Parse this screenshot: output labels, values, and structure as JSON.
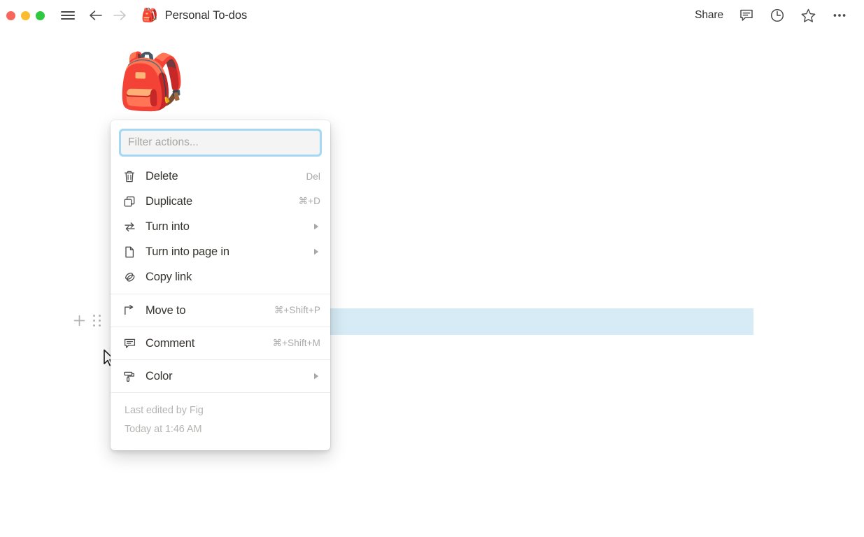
{
  "titlebar": {
    "window_controls": [
      {
        "name": "close",
        "color": "#f9655b"
      },
      {
        "name": "minimize",
        "color": "#fbbd2e"
      },
      {
        "name": "maximize",
        "color": "#2fc840"
      }
    ],
    "menu_icon": "hamburger-icon",
    "back_icon": "arrow-left-icon",
    "forward_icon": "arrow-right-icon",
    "doc_emoji": "🎒",
    "doc_title": "Personal To-dos",
    "share_label": "Share",
    "comment_icon": "comment-icon",
    "history_icon": "clock-icon",
    "favorite_icon": "star-icon",
    "more_icon": "ellipsis-icon"
  },
  "page": {
    "emoji": "🎒",
    "title": "Personal To-dos",
    "block_highlight_color": "#d6ebf5",
    "add_block_icon": "plus-icon",
    "drag_handle_icon": "drag-handle-icon"
  },
  "context_menu": {
    "filter": {
      "value": "",
      "placeholder": "Filter actions..."
    },
    "groups": [
      {
        "items": [
          {
            "icon": "trash-icon",
            "label": "Delete",
            "shortcut": "Del",
            "submenu": false
          },
          {
            "icon": "duplicate-icon",
            "label": "Duplicate",
            "shortcut": "⌘+D",
            "submenu": false
          },
          {
            "icon": "swap-icon",
            "label": "Turn into",
            "shortcut": "",
            "submenu": true
          },
          {
            "icon": "page-icon",
            "label": "Turn into page in",
            "shortcut": "",
            "submenu": true
          },
          {
            "icon": "link-icon",
            "label": "Copy link",
            "shortcut": "",
            "submenu": false
          }
        ]
      },
      {
        "items": [
          {
            "icon": "move-arrow-icon",
            "label": "Move to",
            "shortcut": "⌘+Shift+P",
            "submenu": false
          }
        ]
      },
      {
        "items": [
          {
            "icon": "comment-bubble-icon",
            "label": "Comment",
            "shortcut": "⌘+Shift+M",
            "submenu": false
          }
        ]
      },
      {
        "items": [
          {
            "icon": "paint-roller-icon",
            "label": "Color",
            "shortcut": "",
            "submenu": true
          }
        ]
      }
    ],
    "footer": {
      "edited_by": "Last edited by Fig",
      "edited_at": "Today at 1:46 AM"
    }
  }
}
